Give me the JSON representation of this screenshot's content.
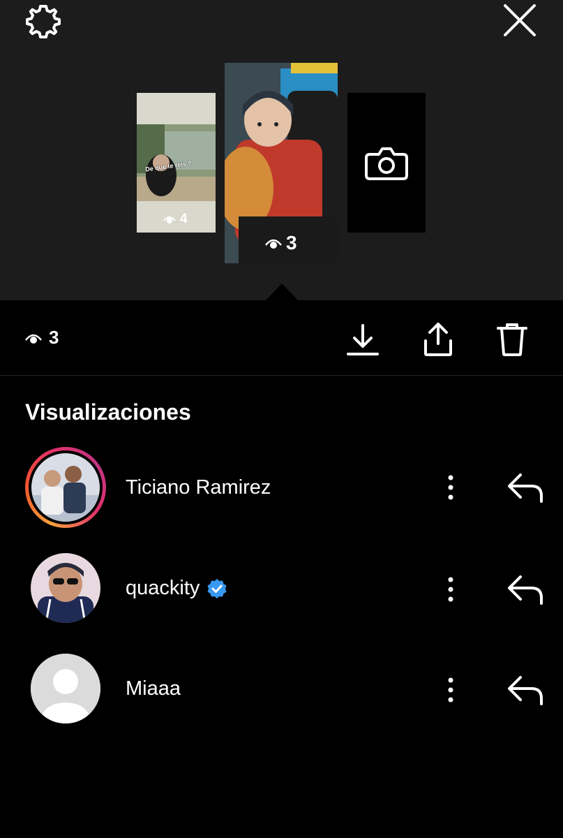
{
  "header": {
    "settings_icon": "gear-icon",
    "close_icon": "close-icon"
  },
  "stories": [
    {
      "caption": "De que te reis ?",
      "views": "4"
    },
    {
      "views": "3"
    },
    {
      "icon": "camera-icon"
    }
  ],
  "actions": {
    "views": "3",
    "download_icon": "download-icon",
    "share_icon": "share-icon",
    "delete_icon": "trash-icon"
  },
  "viewers_section": {
    "title": "Visualizaciones",
    "viewers": [
      {
        "name": "Ticiano Ramirez",
        "verified": false,
        "has_story_ring": true
      },
      {
        "name": "quackity",
        "verified": true,
        "has_story_ring": false
      },
      {
        "name": "Miaaa",
        "verified": false,
        "has_story_ring": false
      }
    ]
  },
  "colors": {
    "background": "#000000",
    "top_area": "#1c1c1c",
    "verified_badge": "#3897f0"
  }
}
